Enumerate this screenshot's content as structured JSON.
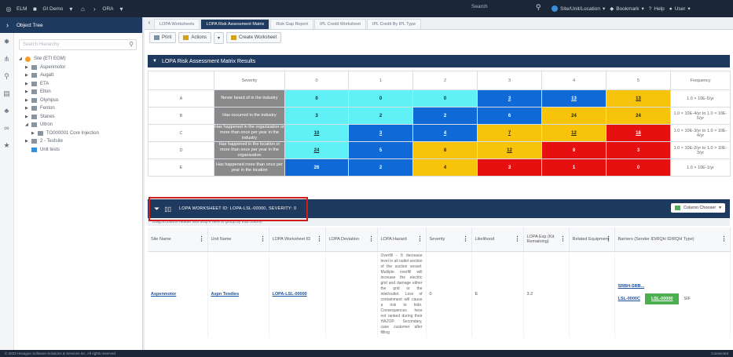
{
  "topbar": {
    "app_name": "ELM",
    "product": "GI Demo",
    "module": "ORA",
    "search_placeholder": "Search",
    "right_items": [
      "Site/Unit/Location",
      "Bookmark",
      "Help",
      "User"
    ]
  },
  "left_panel": {
    "title": "Object Tree",
    "search_placeholder": "Search Hierarchy",
    "tree": [
      {
        "label": "Site (ETI EGM)",
        "depth": 0,
        "icon": "site"
      },
      {
        "label": "Aspenmotor",
        "depth": 1,
        "icon": "folder"
      },
      {
        "label": "Augatt",
        "depth": 1,
        "icon": "folder"
      },
      {
        "label": "ETA",
        "depth": 1,
        "icon": "folder"
      },
      {
        "label": "Elton",
        "depth": 1,
        "icon": "folder"
      },
      {
        "label": "Olympus",
        "depth": 1,
        "icon": "folder"
      },
      {
        "label": "Fenton",
        "depth": 1,
        "icon": "folder"
      },
      {
        "label": "Stanes",
        "depth": 1,
        "icon": "folder"
      },
      {
        "label": "Ultron",
        "depth": 1,
        "icon": "folder"
      },
      {
        "label": "TO000001 Core Injection",
        "depth": 2,
        "icon": "folder"
      },
      {
        "label": "2 - Testsite",
        "depth": 1,
        "icon": "folder"
      },
      {
        "label": "Unit tests",
        "depth": 1,
        "icon": "doc"
      }
    ]
  },
  "tabs": [
    "LOPA Worksheets",
    "LOPA Risk Assessment Matrix",
    "Risk Gap Report",
    "IPL Credit Worksheet",
    "IPL Credit By IPL Type"
  ],
  "toolbar": {
    "print": "Print",
    "actions": "Actions",
    "create": "Create Worksheet"
  },
  "section_title": "LOPA Risk Assessment Matrix Results",
  "matrix": {
    "header": [
      "",
      "Severity",
      "0",
      "1",
      "2",
      "3",
      "4",
      "5",
      "Frequency"
    ],
    "rows": [
      {
        "label": "A",
        "desc": "Never heard of in the industry",
        "cells": [
          "0",
          "0",
          "0",
          "3",
          "13",
          "13"
        ],
        "freq": "1.0 × 10E-5/yr"
      },
      {
        "label": "B",
        "desc": "Has occurred in the industry",
        "cells": [
          "3",
          "2",
          "2",
          "6",
          "24",
          "24"
        ],
        "freq": "1.0 × 10E-4/yr to 1.0 × 10E-5/yr"
      },
      {
        "label": "C",
        "desc": "Has happened in the organization or more than once per year in the industry",
        "cells": [
          "10",
          "3",
          "4",
          "7",
          "12",
          "16"
        ],
        "freq": "1.0 × 10E-3/yr to 1.0 × 10E-4/yr"
      },
      {
        "label": "D",
        "desc": "Has happened in the location or more than once per year in the organization",
        "cells": [
          "24",
          "5",
          "8",
          "12",
          "8",
          "3"
        ],
        "freq": "1.0 × 10E-2/yr to 1.0 × 10E-3/yr"
      },
      {
        "label": "E",
        "desc": "Has happened more than once per year in the location",
        "cells": [
          "26",
          "2",
          "4",
          "3",
          "1",
          "0"
        ],
        "freq": "1.0 × 10E-1/yr"
      }
    ],
    "colors": {
      "cyan": "#5ff1f6",
      "blue": "#0f6ad8",
      "yellow": "#f7c40b",
      "red": "#e61010"
    }
  },
  "filter": {
    "text": "LOPA WORKSHEET ID: LOPA-LSL-00000, SEVERITY: 0",
    "column_button": "Column Chooser"
  },
  "group_hint": "Drag a column header and drop it here to group by that column",
  "grid": {
    "columns": [
      "Site Name",
      "Unit Name",
      "LOPA Worksheet ID",
      "LOPA Deviation",
      "LOPA Hazard",
      "Severity",
      "Likelihood",
      "LOPA Exp (Kit Remaining)",
      "Related Equipment",
      "Barriers (Sender ID/RQH ID/RQH Type)"
    ],
    "row": {
      "site": "Aspenmotor",
      "unit": "Aspn Teodies",
      "worksheet": "LOPA-LSL-00000",
      "deviation": "",
      "hazard": "Overfill - It decrease level in all outlet section of the suction vessel. Multiple overfill will increase the electric grid and damage either the grid or the inlet/outlet. Loss of containment will cause a risk to hide. Consequences here not ranked during their HAZOP. Secondary, case customer after filling",
      "severity": "0",
      "likelihood": "E",
      "exp": "3.2",
      "equipment": "",
      "barrier_top": "SRBH-SRB...",
      "barrier_a": "LSL-0000C",
      "barrier_b": "LSL-00000",
      "barrier_c": "SIF"
    }
  },
  "bottom": {
    "left": "© 2023 Hexagon Software Solutions & Services Inc. All rights reserved.",
    "right": "Connected"
  }
}
